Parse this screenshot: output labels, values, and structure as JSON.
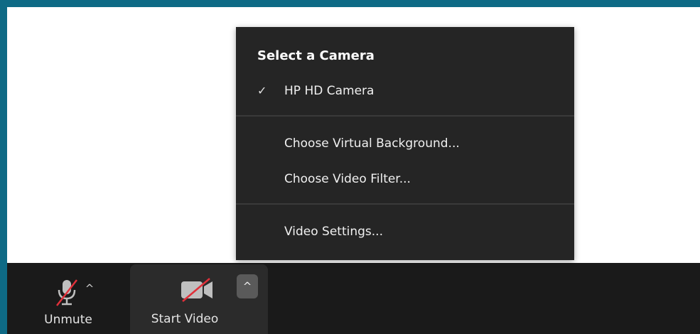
{
  "menu": {
    "header": "Select a Camera",
    "camera_item": "HP HD Camera",
    "virtual_background": "Choose Virtual Background...",
    "video_filter": "Choose Video Filter...",
    "video_settings": "Video Settings..."
  },
  "toolbar": {
    "unmute_label": "Unmute",
    "start_video_label": "Start Video"
  },
  "icons": {
    "check": "✓",
    "caret_up": "^"
  },
  "colors": {
    "frame": "#0e6a85",
    "toolbar_bg": "#1a1a1a",
    "menu_bg": "#252525",
    "muted_red": "#e0303a"
  }
}
